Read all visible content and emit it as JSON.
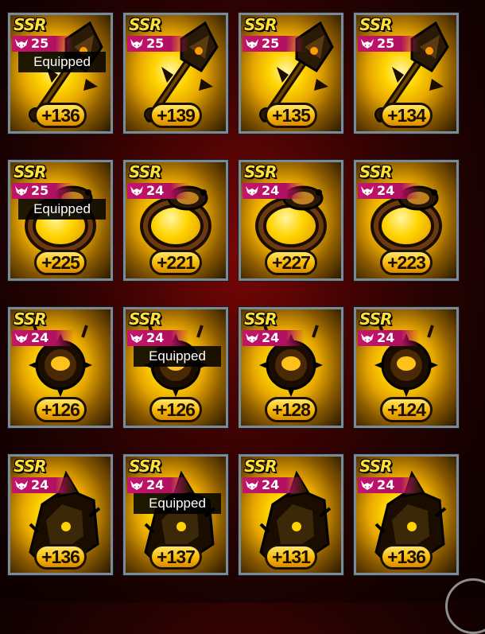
{
  "items": [
    {
      "rarity": "SSR",
      "level": "25",
      "plus": "+136",
      "type": "weapon",
      "equipped": true,
      "equipped_label": "Equipped"
    },
    {
      "rarity": "SSR",
      "level": "25",
      "plus": "+139",
      "type": "weapon",
      "equipped": false,
      "equipped_label": ""
    },
    {
      "rarity": "SSR",
      "level": "25",
      "plus": "+135",
      "type": "weapon",
      "equipped": false,
      "equipped_label": ""
    },
    {
      "rarity": "SSR",
      "level": "25",
      "plus": "+134",
      "type": "weapon",
      "equipped": false,
      "equipped_label": ""
    },
    {
      "rarity": "SSR",
      "level": "25",
      "plus": "+225",
      "type": "ring",
      "equipped": true,
      "equipped_label": "Equipped"
    },
    {
      "rarity": "SSR",
      "level": "24",
      "plus": "+221",
      "type": "ring",
      "equipped": false,
      "equipped_label": ""
    },
    {
      "rarity": "SSR",
      "level": "24",
      "plus": "+227",
      "type": "ring",
      "equipped": false,
      "equipped_label": ""
    },
    {
      "rarity": "SSR",
      "level": "24",
      "plus": "+223",
      "type": "ring",
      "equipped": false,
      "equipped_label": ""
    },
    {
      "rarity": "SSR",
      "level": "24",
      "plus": "+126",
      "type": "necklace",
      "equipped": false,
      "equipped_label": ""
    },
    {
      "rarity": "SSR",
      "level": "24",
      "plus": "+126",
      "type": "necklace",
      "equipped": true,
      "equipped_label": "Equipped"
    },
    {
      "rarity": "SSR",
      "level": "24",
      "plus": "+128",
      "type": "necklace",
      "equipped": false,
      "equipped_label": ""
    },
    {
      "rarity": "SSR",
      "level": "24",
      "plus": "+124",
      "type": "necklace",
      "equipped": false,
      "equipped_label": ""
    },
    {
      "rarity": "SSR",
      "level": "24",
      "plus": "+136",
      "type": "armor",
      "equipped": false,
      "equipped_label": ""
    },
    {
      "rarity": "SSR",
      "level": "24",
      "plus": "+137",
      "type": "armor",
      "equipped": true,
      "equipped_label": "Equipped"
    },
    {
      "rarity": "SSR",
      "level": "24",
      "plus": "+131",
      "type": "armor",
      "equipped": false,
      "equipped_label": ""
    },
    {
      "rarity": "SSR",
      "level": "24",
      "plus": "+136",
      "type": "armor",
      "equipped": false,
      "equipped_label": ""
    }
  ],
  "colors": {
    "rarity": "#ffe034",
    "level_badge": "#c4156e",
    "plus_badge": "#f7b800",
    "card_border": "#7a8a98",
    "background": "#4a0303"
  },
  "icons": {
    "level": "demon-horns-icon",
    "weapon": "mace-icon",
    "ring": "ring-icon",
    "necklace": "necklace-icon",
    "armor": "gauntlet-icon"
  }
}
